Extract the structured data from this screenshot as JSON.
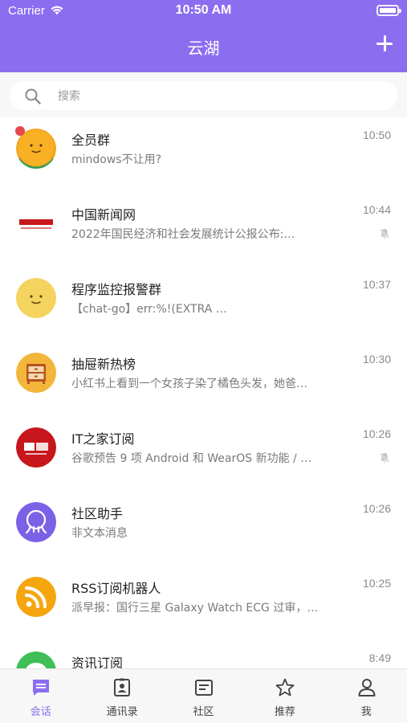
{
  "status_bar": {
    "carrier": "Carrier",
    "time": "10:50 AM"
  },
  "header": {
    "title": "云湖"
  },
  "search": {
    "placeholder": "搜索"
  },
  "conversations": [
    {
      "name": "全员群",
      "preview": "mindows不让用?",
      "time": "10:50"
    },
    {
      "name": "中国新闻网",
      "preview": "2022年国民经济和社会发展统计公报公布:…",
      "time": "10:44"
    },
    {
      "name": "程序监控报警群",
      "preview": "【chat-go】err:%!(EXTRA …",
      "time": "10:37"
    },
    {
      "name": "抽屉新热榜",
      "preview": "小红书上看到一个女孩子染了橘色头发，她爸…",
      "time": "10:30"
    },
    {
      "name": "IT之家订阅",
      "preview": "谷歌预告 9 项 Android 和 WearOS 新功能 / …",
      "time": "10:26"
    },
    {
      "name": "社区助手",
      "preview": "非文本消息",
      "time": "10:26"
    },
    {
      "name": "RSS订阅机器人",
      "preview": "派早报：国行三星 Galaxy Watch ECG 过审，…",
      "time": "10:25"
    },
    {
      "name": "资讯订阅",
      "preview": "",
      "time": "8:49"
    }
  ],
  "avatars": {
    "chinanews_logo": "中国新闻网",
    "ithome_logo": "IT之家"
  },
  "tabs": [
    {
      "label": "会话",
      "icon": "chat-icon"
    },
    {
      "label": "通讯录",
      "icon": "contacts-icon"
    },
    {
      "label": "社区",
      "icon": "community-icon"
    },
    {
      "label": "推荐",
      "icon": "star-icon"
    },
    {
      "label": "我",
      "icon": "person-icon"
    }
  ],
  "colors": {
    "accent": "#8b6ef0",
    "unread_dot": "#e5484d",
    "header_text": "#ffffff"
  }
}
